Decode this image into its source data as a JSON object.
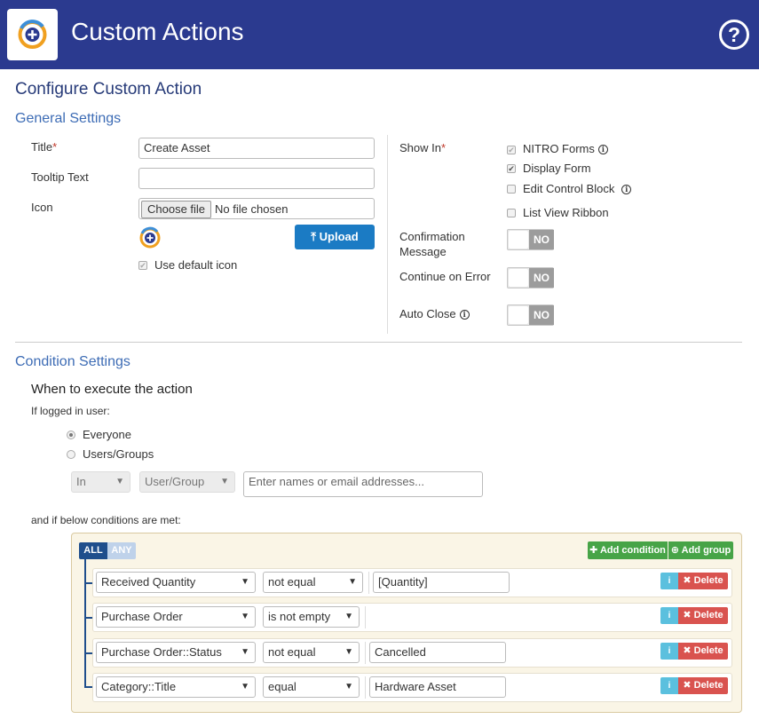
{
  "header": {
    "title": "Custom Actions",
    "help_glyph": "?"
  },
  "page": {
    "heading": "Configure Custom Action"
  },
  "general": {
    "heading": "General Settings",
    "title_label": "Title",
    "title_value": "Create Asset",
    "tooltip_label": "Tooltip Text",
    "tooltip_value": "",
    "icon_label": "Icon",
    "choose_file_label": "Choose file",
    "no_file_text": "No file chosen",
    "upload_label": "Upload",
    "use_default_icon_label": "Use default icon",
    "show_in_label": "Show In",
    "show_in_options": [
      {
        "label": "NITRO Forms",
        "checked": true,
        "disabled": true
      },
      {
        "label": "Display Form",
        "checked": true,
        "disabled": false
      },
      {
        "label": "Edit Control Block",
        "checked": false,
        "disabled": false
      },
      {
        "label": "List View Ribbon",
        "checked": false,
        "disabled": false
      }
    ],
    "confirmation_label_1": "Confirmation",
    "confirmation_label_2": "Message",
    "continue_label": "Continue on Error",
    "auto_close_label": "Auto Close",
    "toggle_off_text": "NO"
  },
  "conditions": {
    "heading": "Condition Settings",
    "subheading": "When to execute the action",
    "logged_in_label": "If logged in user:",
    "everyone_label": "Everyone",
    "users_groups_label": "Users/Groups",
    "in_select": "In",
    "user_group_select": "User/Group",
    "names_placeholder": "Enter names or email addresses...",
    "below_label": "and if below conditions are met:",
    "all_label": "ALL",
    "any_label": "ANY",
    "add_condition_label": "Add condition",
    "add_group_label": "Add group",
    "delete_label": "Delete",
    "rows": [
      {
        "field": "Received Quantity",
        "operator": "not equal",
        "value": "[Quantity]"
      },
      {
        "field": "Purchase Order",
        "operator": "is not empty",
        "value": ""
      },
      {
        "field": "Purchase Order::Status",
        "operator": "not equal",
        "value": "Cancelled"
      },
      {
        "field": "Category::Title",
        "operator": "equal",
        "value": "Hardware Asset"
      }
    ]
  },
  "colors": {
    "header": "#2b3a8f",
    "section": "#3d6cb5",
    "upload": "#1b7bc4",
    "add": "#47a447",
    "delete": "#d9534f",
    "info": "#5bc0de"
  }
}
